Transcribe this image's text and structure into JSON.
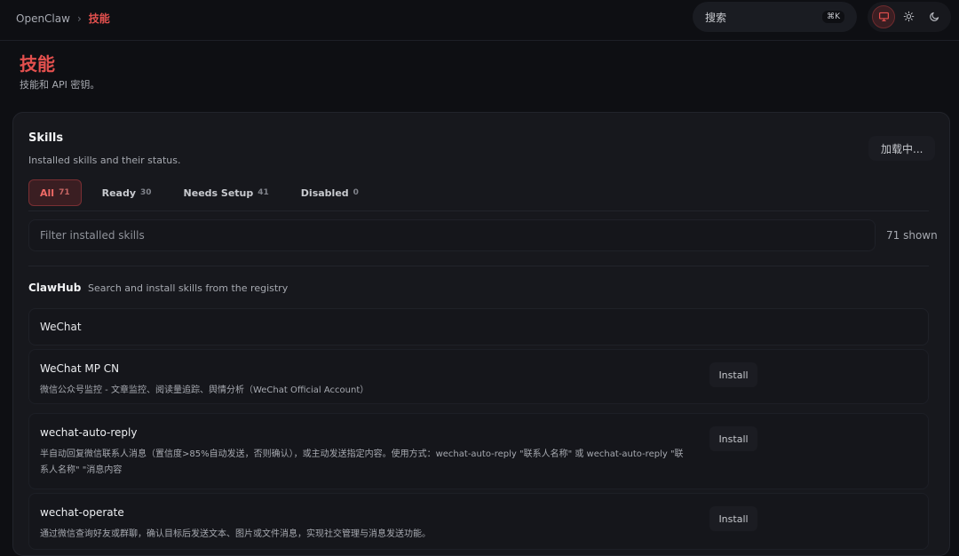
{
  "breadcrumb": {
    "root": "OpenClaw",
    "separator": "›",
    "current": "技能"
  },
  "search": {
    "label": "搜索",
    "shortcut": "⌘K"
  },
  "theme": {
    "options": [
      {
        "name": "system",
        "icon": "monitor-icon",
        "active": true
      },
      {
        "name": "light",
        "icon": "sun-icon",
        "active": false
      },
      {
        "name": "dark",
        "icon": "moon-icon",
        "active": false
      }
    ]
  },
  "page": {
    "title": "技能",
    "subtitle": "技能和 API 密钥。"
  },
  "skills": {
    "title": "Skills",
    "description": "Installed skills and their status.",
    "loading_label": "加载中...",
    "tabs": [
      {
        "label": "All",
        "count": "71",
        "active": true
      },
      {
        "label": "Ready",
        "count": "30",
        "active": false
      },
      {
        "label": "Needs Setup",
        "count": "41",
        "active": false
      },
      {
        "label": "Disabled",
        "count": "0",
        "active": false
      }
    ],
    "filter_placeholder": "Filter installed skills",
    "shown_label": "71 shown"
  },
  "clawhub": {
    "title": "ClawHub",
    "description": "Search and install skills from the registry",
    "query": "WeChat",
    "install_label": "Install",
    "results": [
      {
        "name": "WeChat MP CN",
        "description": "微信公众号监控 - 文章监控、阅读量追踪、舆情分析（WeChat Official Account）"
      },
      {
        "name": "wechat-auto-reply",
        "description": "半自动回复微信联系人消息（置信度>85%自动发送，否则确认），或主动发送指定内容。使用方式：wechat-auto-reply \"联系人名称\" 或 wechat-auto-reply \"联系人名称\" \"消息内容"
      },
      {
        "name": "wechat-operate",
        "description": "通过微信查询好友或群聊，确认目标后发送文本、图片或文件消息，实现社交管理与消息发送功能。"
      }
    ]
  },
  "colors": {
    "background": "#0e0f13",
    "card": "#17181d",
    "accent": "#e3504e",
    "muted_text": "#a6a9b0"
  }
}
